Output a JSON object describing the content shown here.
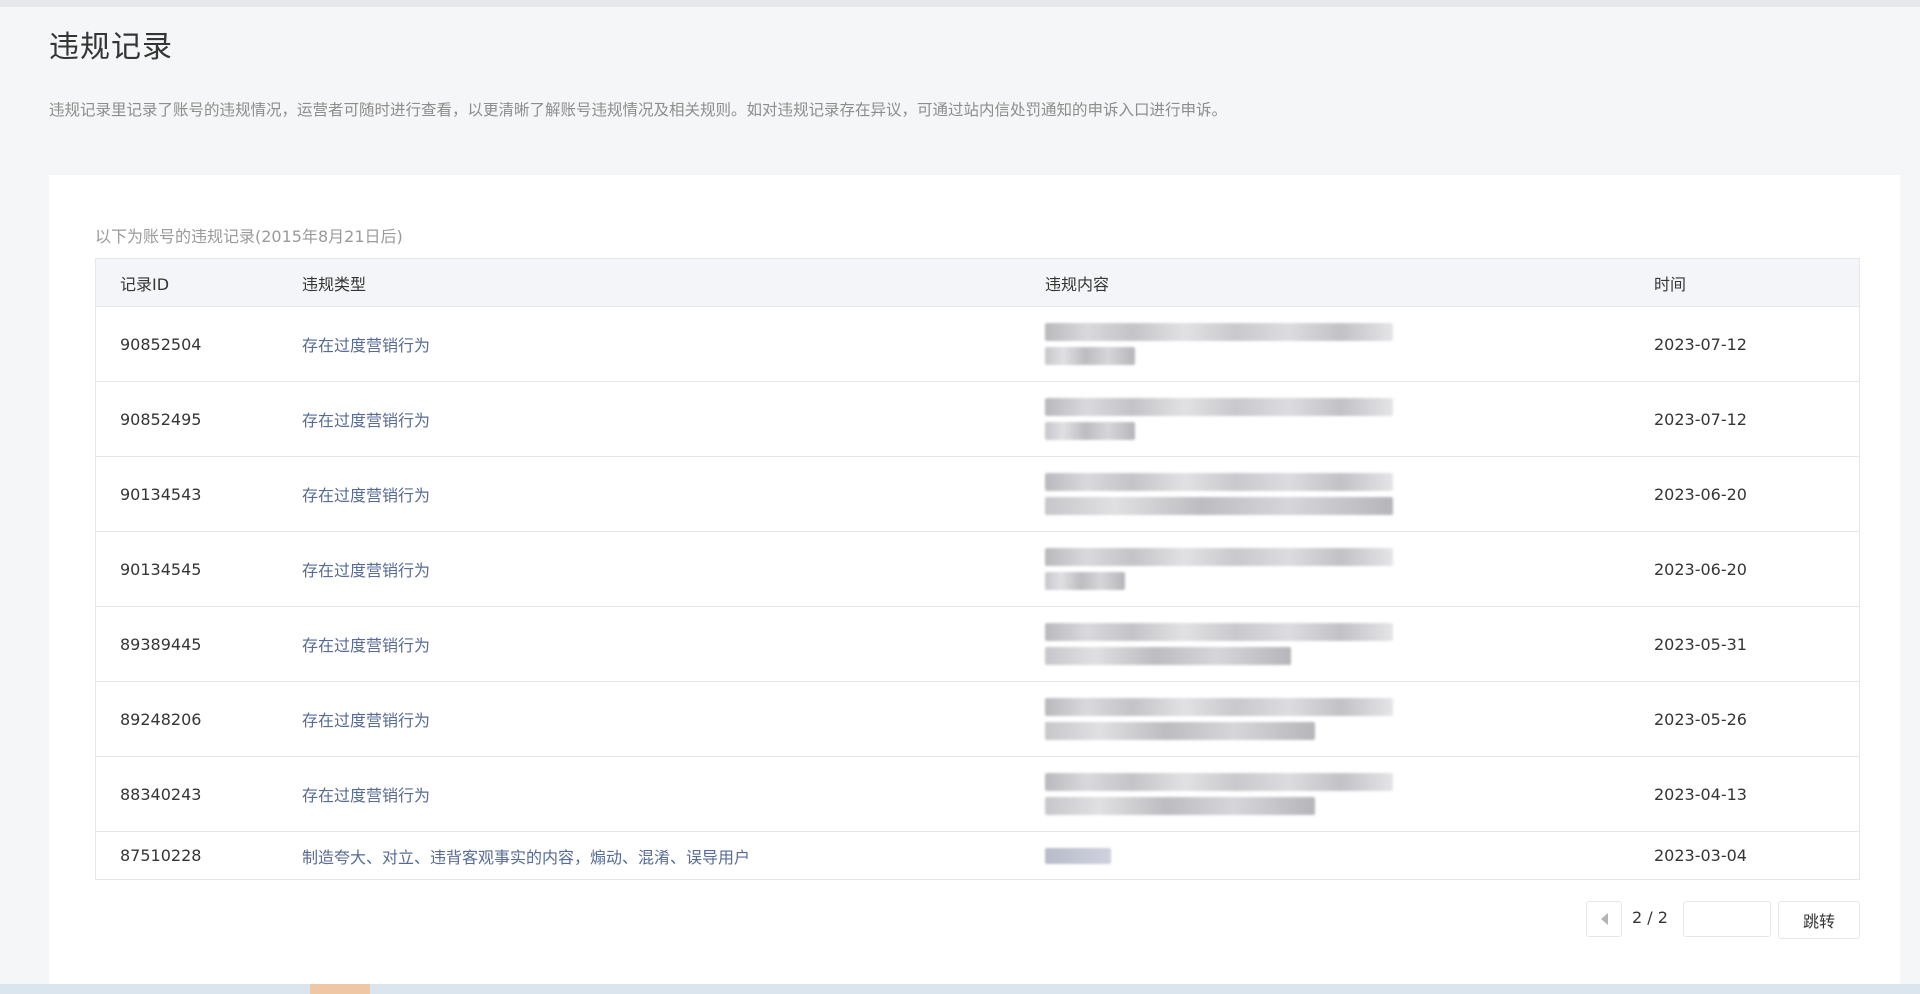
{
  "page": {
    "title": "违规记录",
    "description": "违规记录里记录了账号的违规情况，运营者可随时进行查看，以更清晰了解账号违规情况及相关规则。如对违规记录存在异议，可通过站内信处罚通知的申诉入口进行申诉。"
  },
  "records": {
    "subtitle": "以下为账号的违规记录(2015年8月21日后)",
    "headers": {
      "id": "记录ID",
      "type": "违规类型",
      "content": "违规内容",
      "time": "时间"
    },
    "rows": [
      {
        "id": "90852504",
        "type": "存在过度营销行为",
        "time": "2023-07-12"
      },
      {
        "id": "90852495",
        "type": "存在过度营销行为",
        "time": "2023-07-12"
      },
      {
        "id": "90134543",
        "type": "存在过度营销行为",
        "time": "2023-06-20"
      },
      {
        "id": "90134545",
        "type": "存在过度营销行为",
        "time": "2023-06-20"
      },
      {
        "id": "89389445",
        "type": "存在过度营销行为",
        "time": "2023-05-31"
      },
      {
        "id": "89248206",
        "type": "存在过度营销行为",
        "time": "2023-05-26"
      },
      {
        "id": "88340243",
        "type": "存在过度营销行为",
        "time": "2023-04-13"
      },
      {
        "id": "87510228",
        "type": "制造夸大、对立、违背客观事实的内容，煽动、混淆、误导用户",
        "time": "2023-03-04"
      }
    ]
  },
  "pagination": {
    "page_label": "2 / 2",
    "input_value": "",
    "jump_label": "跳转"
  },
  "colors": {
    "link": "#576b95",
    "header_bg": "#f4f5f9",
    "page_bg": "#f5f6f7"
  }
}
